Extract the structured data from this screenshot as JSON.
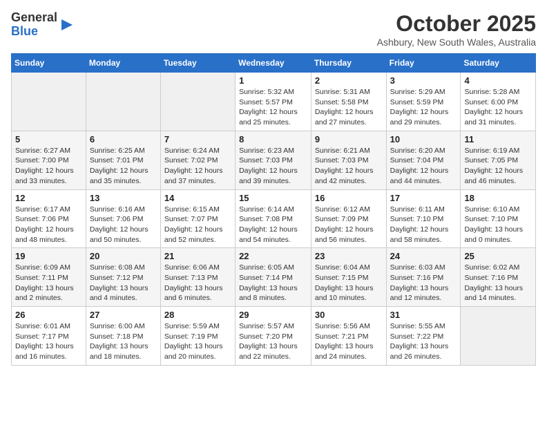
{
  "logo": {
    "general": "General",
    "blue": "Blue"
  },
  "title": "October 2025",
  "location": "Ashbury, New South Wales, Australia",
  "days_of_week": [
    "Sunday",
    "Monday",
    "Tuesday",
    "Wednesday",
    "Thursday",
    "Friday",
    "Saturday"
  ],
  "weeks": [
    [
      {
        "num": "",
        "empty": true
      },
      {
        "num": "",
        "empty": true
      },
      {
        "num": "",
        "empty": true
      },
      {
        "num": "1",
        "sunrise": "Sunrise: 5:32 AM",
        "sunset": "Sunset: 5:57 PM",
        "daylight": "Daylight: 12 hours and 25 minutes."
      },
      {
        "num": "2",
        "sunrise": "Sunrise: 5:31 AM",
        "sunset": "Sunset: 5:58 PM",
        "daylight": "Daylight: 12 hours and 27 minutes."
      },
      {
        "num": "3",
        "sunrise": "Sunrise: 5:29 AM",
        "sunset": "Sunset: 5:59 PM",
        "daylight": "Daylight: 12 hours and 29 minutes."
      },
      {
        "num": "4",
        "sunrise": "Sunrise: 5:28 AM",
        "sunset": "Sunset: 6:00 PM",
        "daylight": "Daylight: 12 hours and 31 minutes."
      }
    ],
    [
      {
        "num": "5",
        "sunrise": "Sunrise: 6:27 AM",
        "sunset": "Sunset: 7:00 PM",
        "daylight": "Daylight: 12 hours and 33 minutes."
      },
      {
        "num": "6",
        "sunrise": "Sunrise: 6:25 AM",
        "sunset": "Sunset: 7:01 PM",
        "daylight": "Daylight: 12 hours and 35 minutes."
      },
      {
        "num": "7",
        "sunrise": "Sunrise: 6:24 AM",
        "sunset": "Sunset: 7:02 PM",
        "daylight": "Daylight: 12 hours and 37 minutes."
      },
      {
        "num": "8",
        "sunrise": "Sunrise: 6:23 AM",
        "sunset": "Sunset: 7:03 PM",
        "daylight": "Daylight: 12 hours and 39 minutes."
      },
      {
        "num": "9",
        "sunrise": "Sunrise: 6:21 AM",
        "sunset": "Sunset: 7:03 PM",
        "daylight": "Daylight: 12 hours and 42 minutes."
      },
      {
        "num": "10",
        "sunrise": "Sunrise: 6:20 AM",
        "sunset": "Sunset: 7:04 PM",
        "daylight": "Daylight: 12 hours and 44 minutes."
      },
      {
        "num": "11",
        "sunrise": "Sunrise: 6:19 AM",
        "sunset": "Sunset: 7:05 PM",
        "daylight": "Daylight: 12 hours and 46 minutes."
      }
    ],
    [
      {
        "num": "12",
        "sunrise": "Sunrise: 6:17 AM",
        "sunset": "Sunset: 7:06 PM",
        "daylight": "Daylight: 12 hours and 48 minutes."
      },
      {
        "num": "13",
        "sunrise": "Sunrise: 6:16 AM",
        "sunset": "Sunset: 7:06 PM",
        "daylight": "Daylight: 12 hours and 50 minutes."
      },
      {
        "num": "14",
        "sunrise": "Sunrise: 6:15 AM",
        "sunset": "Sunset: 7:07 PM",
        "daylight": "Daylight: 12 hours and 52 minutes."
      },
      {
        "num": "15",
        "sunrise": "Sunrise: 6:14 AM",
        "sunset": "Sunset: 7:08 PM",
        "daylight": "Daylight: 12 hours and 54 minutes."
      },
      {
        "num": "16",
        "sunrise": "Sunrise: 6:12 AM",
        "sunset": "Sunset: 7:09 PM",
        "daylight": "Daylight: 12 hours and 56 minutes."
      },
      {
        "num": "17",
        "sunrise": "Sunrise: 6:11 AM",
        "sunset": "Sunset: 7:10 PM",
        "daylight": "Daylight: 12 hours and 58 minutes."
      },
      {
        "num": "18",
        "sunrise": "Sunrise: 6:10 AM",
        "sunset": "Sunset: 7:10 PM",
        "daylight": "Daylight: 13 hours and 0 minutes."
      }
    ],
    [
      {
        "num": "19",
        "sunrise": "Sunrise: 6:09 AM",
        "sunset": "Sunset: 7:11 PM",
        "daylight": "Daylight: 13 hours and 2 minutes."
      },
      {
        "num": "20",
        "sunrise": "Sunrise: 6:08 AM",
        "sunset": "Sunset: 7:12 PM",
        "daylight": "Daylight: 13 hours and 4 minutes."
      },
      {
        "num": "21",
        "sunrise": "Sunrise: 6:06 AM",
        "sunset": "Sunset: 7:13 PM",
        "daylight": "Daylight: 13 hours and 6 minutes."
      },
      {
        "num": "22",
        "sunrise": "Sunrise: 6:05 AM",
        "sunset": "Sunset: 7:14 PM",
        "daylight": "Daylight: 13 hours and 8 minutes."
      },
      {
        "num": "23",
        "sunrise": "Sunrise: 6:04 AM",
        "sunset": "Sunset: 7:15 PM",
        "daylight": "Daylight: 13 hours and 10 minutes."
      },
      {
        "num": "24",
        "sunrise": "Sunrise: 6:03 AM",
        "sunset": "Sunset: 7:16 PM",
        "daylight": "Daylight: 13 hours and 12 minutes."
      },
      {
        "num": "25",
        "sunrise": "Sunrise: 6:02 AM",
        "sunset": "Sunset: 7:16 PM",
        "daylight": "Daylight: 13 hours and 14 minutes."
      }
    ],
    [
      {
        "num": "26",
        "sunrise": "Sunrise: 6:01 AM",
        "sunset": "Sunset: 7:17 PM",
        "daylight": "Daylight: 13 hours and 16 minutes."
      },
      {
        "num": "27",
        "sunrise": "Sunrise: 6:00 AM",
        "sunset": "Sunset: 7:18 PM",
        "daylight": "Daylight: 13 hours and 18 minutes."
      },
      {
        "num": "28",
        "sunrise": "Sunrise: 5:59 AM",
        "sunset": "Sunset: 7:19 PM",
        "daylight": "Daylight: 13 hours and 20 minutes."
      },
      {
        "num": "29",
        "sunrise": "Sunrise: 5:57 AM",
        "sunset": "Sunset: 7:20 PM",
        "daylight": "Daylight: 13 hours and 22 minutes."
      },
      {
        "num": "30",
        "sunrise": "Sunrise: 5:56 AM",
        "sunset": "Sunset: 7:21 PM",
        "daylight": "Daylight: 13 hours and 24 minutes."
      },
      {
        "num": "31",
        "sunrise": "Sunrise: 5:55 AM",
        "sunset": "Sunset: 7:22 PM",
        "daylight": "Daylight: 13 hours and 26 minutes."
      },
      {
        "num": "",
        "empty": true
      }
    ]
  ]
}
